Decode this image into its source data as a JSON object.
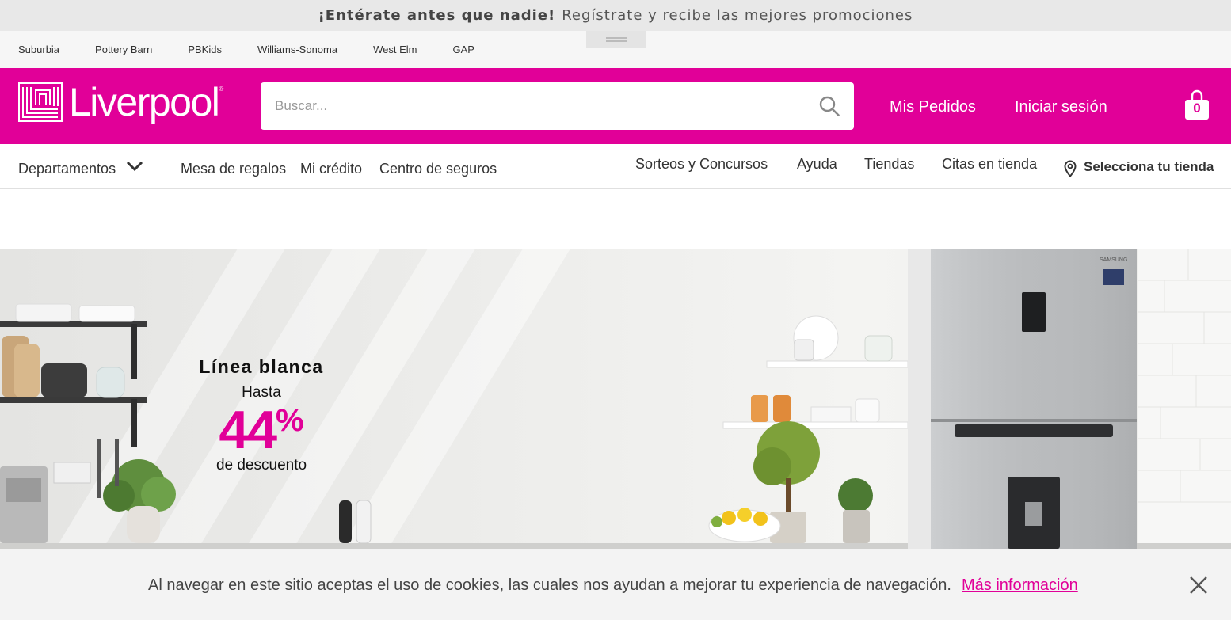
{
  "promo": {
    "bold": "¡Entérate antes que nadie!",
    "text": "Regístrate y recibe las mejores promociones"
  },
  "brands": [
    "Suburbia",
    "Pottery Barn",
    "PBKids",
    "Williams-Sonoma",
    "West Elm",
    "GAP"
  ],
  "header": {
    "logo_text": "Liverpool",
    "search_placeholder": "Buscar...",
    "orders_label": "Mis Pedidos",
    "login_label": "Iniciar sesión",
    "cart_count": "0",
    "brand_color": "#e10098"
  },
  "nav": {
    "departments": "Departamentos",
    "left_items": [
      "Mesa de regalos",
      "Mi crédito",
      "Centro de seguros"
    ],
    "right_items": [
      "Sorteos y Concursos",
      "Ayuda",
      "Tiendas",
      "Citas en tienda"
    ],
    "store_selector": "Selecciona tu tienda"
  },
  "banner": {
    "title": "Línea blanca",
    "hasta": "Hasta",
    "discount_number": "44",
    "discount_sign": "%",
    "subtitle": "de descuento",
    "fridge_brand": "SAMSUNG"
  },
  "cookie": {
    "text": "Al navegar en este sitio aceptas el uso de cookies, las cuales nos ayudan a mejorar tu experiencia de navegación.",
    "link": "Más información"
  },
  "icons": {
    "search": "search-icon",
    "cart": "shopping-bag-icon",
    "chevron": "chevron-down-icon",
    "pin": "location-pin-icon",
    "close": "close-icon"
  }
}
